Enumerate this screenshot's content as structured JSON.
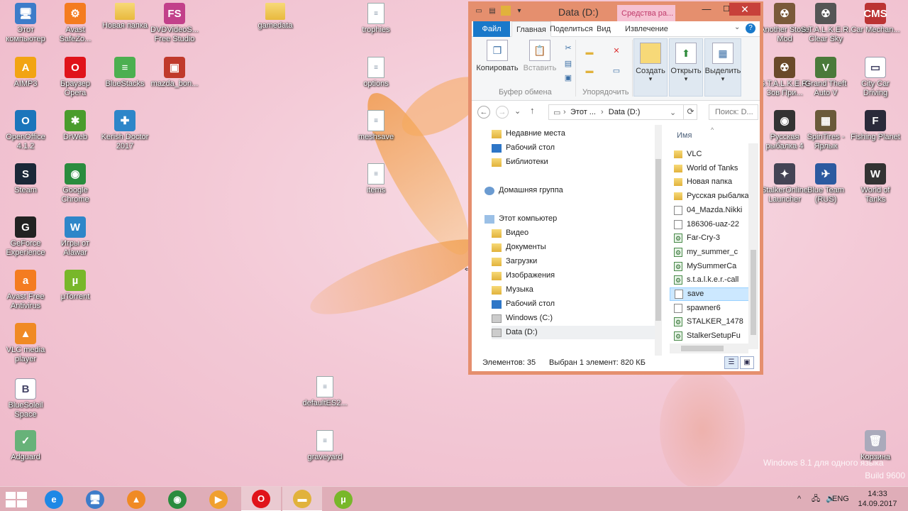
{
  "desktop": {
    "icons_left": [
      {
        "label": "Этот компьютер",
        "glyph": "🖥",
        "color": "#3d7cc9"
      },
      {
        "label": "AIMP3",
        "glyph": "A",
        "color": "#f2a413"
      },
      {
        "label": "OpenOffice 4.1.2",
        "glyph": "O",
        "color": "#1b75bb"
      },
      {
        "label": "Steam",
        "glyph": "S",
        "color": "#1b2838"
      },
      {
        "label": "GeForce Experience",
        "glyph": "G",
        "color": "#222"
      },
      {
        "label": "Avast Free Antivirus",
        "glyph": "a",
        "color": "#f47c20"
      },
      {
        "label": "VLC media player",
        "glyph": "▲",
        "color": "#f08a24"
      },
      {
        "label": "BlueSoleil Space",
        "glyph": "B",
        "color": "#ffffff"
      },
      {
        "label": "Adguard",
        "glyph": "✓",
        "color": "#67b279"
      }
    ],
    "icons_col2": [
      {
        "label": "Avast SafeZo...",
        "glyph": "⚙",
        "color": "#f47c20"
      },
      {
        "label": "Браузер Opera",
        "glyph": "O",
        "color": "#e0131a"
      },
      {
        "label": "DrWeb",
        "glyph": "✱",
        "color": "#4a9c2d"
      },
      {
        "label": "Google Chrome",
        "glyph": "◉",
        "color": "#2a8c3e"
      },
      {
        "label": "Игры от Alawar",
        "glyph": "W",
        "color": "#2e86c9"
      },
      {
        "label": "µTorrent",
        "glyph": "µ",
        "color": "#78b72a"
      }
    ],
    "icons_col3": [
      {
        "label": "Новая папка",
        "glyph": "",
        "color": "#f0c85a"
      },
      {
        "label": "BlueStacks",
        "glyph": "≡",
        "color": "#4caf50"
      },
      {
        "label": "Kerish Doctor 2017",
        "glyph": "✚",
        "color": "#2d86c9"
      }
    ],
    "icons_col4": [
      {
        "label": "DVDVideoS... Free Studio",
        "glyph": "FS",
        "color": "#c2408a"
      },
      {
        "label": "mazda_bon...",
        "glyph": "▣",
        "color": "#c0392b"
      }
    ],
    "icons_mid": [
      {
        "label": "gamedata",
        "glyph": ""
      },
      {
        "label": "trophies",
        "glyph": "≡"
      },
      {
        "label": "options",
        "glyph": "≡"
      },
      {
        "label": "meshsave",
        "glyph": "≡"
      },
      {
        "label": "items",
        "glyph": "≡"
      },
      {
        "label": "defaultES2...",
        "glyph": "≡"
      },
      {
        "label": "graveyard",
        "glyph": "≡"
      }
    ],
    "icons_right_col1": [
      {
        "label": "Another Stove Mod",
        "glyph": "☢",
        "color": "#7a5a3a"
      },
      {
        "label": "S.T.A.L.K.E.R. Зов При...",
        "glyph": "☢",
        "color": "#6a4a2a"
      },
      {
        "label": "Русская рыбалка 4",
        "glyph": "◉",
        "color": "#333"
      },
      {
        "label": "StalkerOnline Launcher",
        "glyph": "✦",
        "color": "#445"
      }
    ],
    "icons_right_col2": [
      {
        "label": "S.T.A.L.K.E.R. Clear Sky",
        "glyph": "☢",
        "color": "#555"
      },
      {
        "label": "Grand Theft Auto V",
        "glyph": "V",
        "color": "#4a7a3a"
      },
      {
        "label": "SpinTires - Ярлык",
        "glyph": "▦",
        "color": "#6a5a3a"
      },
      {
        "label": "Blue Team (RUS)",
        "glyph": "✈",
        "color": "#2c5aa0"
      }
    ],
    "icons_right_col3": [
      {
        "label": "Car Mechan...",
        "glyph": "CMS",
        "color": "#b33"
      },
      {
        "label": "City Car Driving",
        "glyph": "▭",
        "color": "#ffffff"
      },
      {
        "label": "Fishing Planet",
        "glyph": "F",
        "color": "#2a2a3a"
      },
      {
        "label": "World of Tanks",
        "glyph": "W",
        "color": "#333"
      },
      {
        "label": "Корзина",
        "glyph": "🗑",
        "color": "#aab"
      }
    ],
    "watermark": {
      "line1": "Windows 8.1 для одного языка",
      "line2": "Build 9600"
    }
  },
  "explorer": {
    "title": "Data (D:)",
    "tools_tab": "Средства ра...",
    "ribbon_tabs": [
      "Файл",
      "Главная",
      "Поделиться",
      "Вид",
      "Извлечение"
    ],
    "ribbon": {
      "copy": "Копировать",
      "paste": "Вставить",
      "clipboard_group": "Буфер обмена",
      "organize_group": "Упорядочить",
      "create": "Создать",
      "open": "Открыть",
      "select": "Выделить"
    },
    "address": {
      "crumb1": "Этот ...",
      "crumb2": "Data (D:)",
      "search_placeholder": "Поиск: D..."
    },
    "nav": [
      {
        "label": "Недавние места",
        "icon": "f"
      },
      {
        "label": "Рабочий стол",
        "icon": "b"
      },
      {
        "label": "Библиотеки",
        "icon": "f"
      },
      {
        "label": "Домашняя группа",
        "icon": "g"
      },
      {
        "label": "Этот компьютер",
        "icon": "c"
      },
      {
        "label": "Видео",
        "icon": "f"
      },
      {
        "label": "Документы",
        "icon": "f"
      },
      {
        "label": "Загрузки",
        "icon": "f"
      },
      {
        "label": "Изображения",
        "icon": "f"
      },
      {
        "label": "Музыка",
        "icon": "f"
      },
      {
        "label": "Рабочий стол",
        "icon": "b"
      },
      {
        "label": "Windows (C:)",
        "icon": "d"
      },
      {
        "label": "Data (D:)",
        "icon": "d"
      }
    ],
    "files_header": "Имя",
    "files": [
      {
        "name": "VLC",
        "type": "f"
      },
      {
        "name": "World of Tanks",
        "type": "f"
      },
      {
        "name": "Новая папка",
        "type": "f"
      },
      {
        "name": "Русская рыбалка",
        "type": "f"
      },
      {
        "name": "04_Mazda.Nikki",
        "type": "t"
      },
      {
        "name": "186306-uaz-22",
        "type": "t"
      },
      {
        "name": "Far-Cry-3",
        "type": "e"
      },
      {
        "name": "my_summer_c",
        "type": "e"
      },
      {
        "name": "MySummerCa",
        "type": "e"
      },
      {
        "name": "s.t.a.l.k.e.r.-call",
        "type": "e"
      },
      {
        "name": "save",
        "type": "t"
      },
      {
        "name": "spawner6",
        "type": "t"
      },
      {
        "name": "STALKER_1478",
        "type": "e"
      },
      {
        "name": "StalkerSetupFu",
        "type": "e"
      }
    ],
    "status": {
      "count": "Элементов: 35",
      "selected": "Выбран 1 элемент: 820 КБ"
    }
  },
  "taskbar": {
    "apps": [
      {
        "name": "ie",
        "glyph": "e",
        "color": "#1e88e5"
      },
      {
        "name": "computer",
        "glyph": "🖥",
        "color": "#3d7cc9"
      },
      {
        "name": "vlc",
        "glyph": "▲",
        "color": "#f08a24"
      },
      {
        "name": "chrome",
        "glyph": "◉",
        "color": "#2a8c3e"
      },
      {
        "name": "media",
        "glyph": "▶",
        "color": "#f0a030"
      },
      {
        "name": "opera",
        "glyph": "O",
        "color": "#e0131a"
      },
      {
        "name": "explorer",
        "glyph": "▬",
        "color": "#e1b23c"
      },
      {
        "name": "utorrent",
        "glyph": "µ",
        "color": "#78b72a"
      }
    ],
    "tray": {
      "lang": "ENG",
      "time": "14:33",
      "date": "14.09.2017"
    }
  }
}
